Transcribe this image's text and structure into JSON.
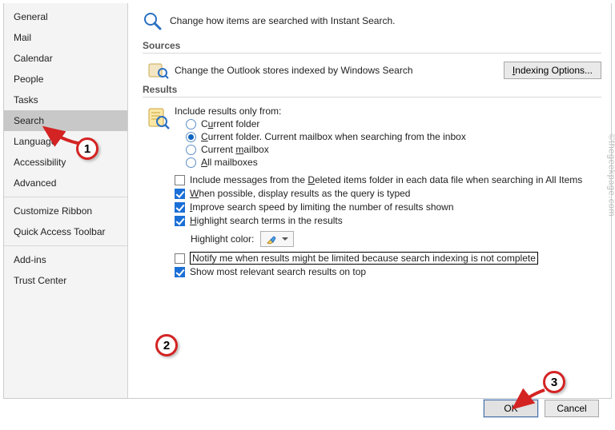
{
  "sidebar": {
    "items": [
      {
        "label": "General"
      },
      {
        "label": "Mail"
      },
      {
        "label": "Calendar"
      },
      {
        "label": "People"
      },
      {
        "label": "Tasks"
      },
      {
        "label": "Search"
      },
      {
        "label": "Language"
      },
      {
        "label": "Accessibility"
      },
      {
        "label": "Advanced"
      },
      {
        "label": "Customize Ribbon"
      },
      {
        "label": "Quick Access Toolbar"
      },
      {
        "label": "Add-ins"
      },
      {
        "label": "Trust Center"
      }
    ],
    "selected_index": 5
  },
  "header": {
    "text": "Change how items are searched with Instant Search."
  },
  "sections": {
    "sources": {
      "title": "Sources",
      "desc": "Change the Outlook stores indexed by Windows Search",
      "button": "Indexing Options..."
    },
    "results": {
      "title": "Results",
      "include_label": "Include results only from:",
      "radios": [
        {
          "pre": "C",
          "u": "u",
          "post": "rrent folder",
          "selected": false
        },
        {
          "pre": "",
          "u": "C",
          "post": "urrent folder. Current mailbox when searching from the inbox",
          "selected": true
        },
        {
          "pre": "Current ",
          "u": "m",
          "post": "ailbox",
          "selected": false
        },
        {
          "pre": "",
          "u": "A",
          "post": "ll mailboxes",
          "selected": false
        }
      ],
      "checks": [
        {
          "pre": "Include messages from the ",
          "u": "D",
          "post": "eleted items folder in each data file when searching in All Items",
          "checked": false
        },
        {
          "pre": "",
          "u": "W",
          "post": "hen possible, display results as the query is typed",
          "checked": true
        },
        {
          "pre": "",
          "u": "I",
          "post": "mprove search speed by limiting the number of results shown",
          "checked": true
        },
        {
          "pre": "",
          "u": "H",
          "post": "ighlight search terms in the results",
          "checked": true
        }
      ],
      "highlight_label": "Highlight color:",
      "notify": {
        "text": "Notify me when results might be limited because search indexing is not complete",
        "checked": false
      },
      "show_top": {
        "text": "Show most relevant search results on top",
        "checked": true
      }
    }
  },
  "buttons": {
    "ok": "OK",
    "cancel": "Cancel"
  },
  "watermark": "©thegeekpage.com",
  "annotations": {
    "a1": "1",
    "a2": "2",
    "a3": "3"
  }
}
